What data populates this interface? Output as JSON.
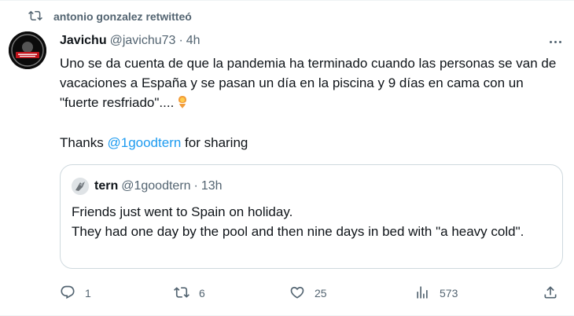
{
  "retweet": {
    "text": "antonio gonzalez retwitteó",
    "icon": "retweet-icon"
  },
  "tweet": {
    "author_name": "Javichu",
    "author_handle": "@javichu73",
    "separator": "·",
    "time": "4h",
    "text": "Uno se da cuenta de que la pandemia ha terminado cuando las personas se van de vacaciones a España y se pasan un día en la piscina y 9 días en cama con un \"fuerte resfriado\"....",
    "emoji": "woman-genie-emoji",
    "thanks_prefix": "Thanks",
    "thanks_mention": "@1goodtern",
    "thanks_suffix": "for sharing"
  },
  "quote": {
    "author_name": "tern",
    "author_handle": "@1goodtern",
    "separator": "·",
    "time": "13h",
    "line1": "Friends just went to Spain on holiday.",
    "line2": "They had one day by the pool and then nine days in bed with \"a heavy cold\"."
  },
  "actions": {
    "replies": "1",
    "retweets": "6",
    "likes": "25",
    "views": "573"
  },
  "colors": {
    "text": "#0f1419",
    "secondary": "#536471",
    "accent": "#1d9bf0",
    "border": "#cfd9de"
  }
}
